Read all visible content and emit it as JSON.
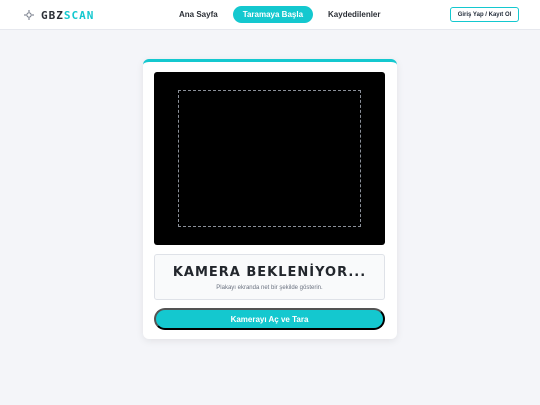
{
  "brand": {
    "logo_prefix": "GBZ",
    "logo_suffix": "SCAN",
    "logo_icon": "scan-target-icon",
    "accent_color": "#14c8cf"
  },
  "nav": {
    "items": [
      {
        "label": "Ana Sayfa",
        "active": false
      },
      {
        "label": "Taramaya Başla",
        "active": true
      },
      {
        "label": "Kaydedilenler",
        "active": false
      }
    ],
    "auth_label": "Giriş Yap / Kayıt Ol"
  },
  "scanner": {
    "status_title": "KAMERA BEKLENİYOR...",
    "status_subtitle": "Plakayı ekranda net bir şekilde gösterin.",
    "button_label": "Kamerayı Aç ve Tara"
  }
}
